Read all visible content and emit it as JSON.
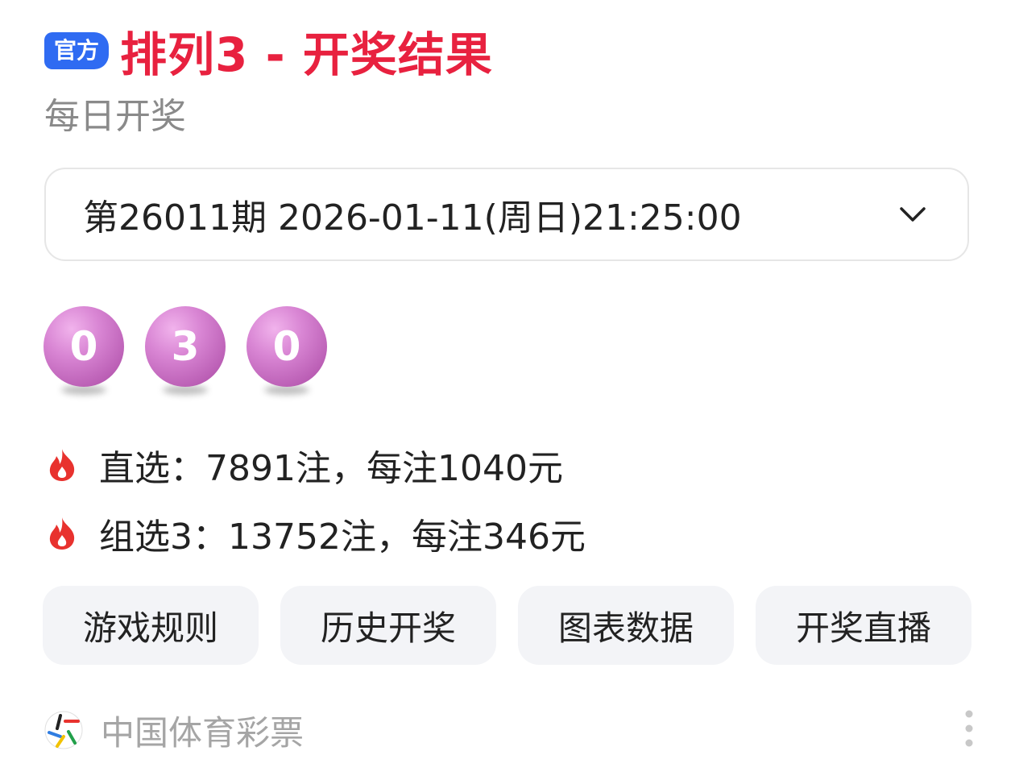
{
  "header": {
    "badge": "官方",
    "title": "排列3 - 开奖结果",
    "subtitle": "每日开奖"
  },
  "period_select": {
    "value": "第26011期 2026-01-11(周日)21:25:00"
  },
  "balls": [
    "0",
    "3",
    "0"
  ],
  "prizes": [
    {
      "text": "直选：7891注，每注1040元",
      "icon": "fire-icon"
    },
    {
      "text": "组选3：13752注，每注346元",
      "icon": "fire-icon"
    }
  ],
  "actions": [
    "游戏规则",
    "历史开奖",
    "图表数据",
    "开奖直播"
  ],
  "footer": {
    "source": "中国体育彩票",
    "logo_icon": "sports-lottery-logo",
    "more_icon": "more-vertical-icon"
  },
  "colors": {
    "title": "#e8213f",
    "badge": "#2f6bf2",
    "ball": "#c96ac4",
    "fire": "#e8322e"
  }
}
